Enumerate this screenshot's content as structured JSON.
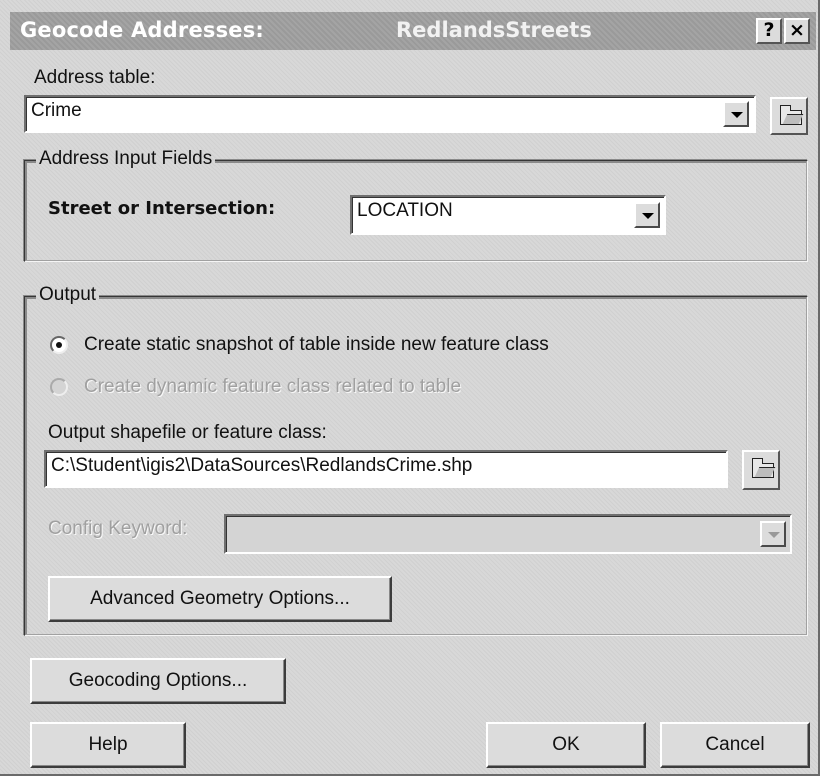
{
  "window": {
    "title": "Geocode Addresses:",
    "title_layer": "RedlandsStreets",
    "help_button": "?",
    "close_button": "×"
  },
  "address_table": {
    "label": "Address table:",
    "value": "Crime"
  },
  "address_input_fields": {
    "legend": "Address Input Fields",
    "street_label": "Street or Intersection:",
    "street_value": "LOCATION"
  },
  "output": {
    "legend": "Output",
    "radio_static_label": "Create static snapshot of table inside new feature class",
    "radio_dynamic_label": "Create dynamic feature class related to table",
    "selected_option": "static",
    "shapefile_label": "Output shapefile or feature class:",
    "shapefile_value": "C:\\Student\\igis2\\DataSources\\RedlandsCrime.shp",
    "config_keyword_label": "Config Keyword:",
    "config_keyword_value": "",
    "advanced_button": "Advanced Geometry Options..."
  },
  "buttons": {
    "geocoding_options": "Geocoding Options...",
    "help": "Help",
    "ok": "OK",
    "cancel": "Cancel"
  },
  "icons": {
    "browse": "open-folder-icon",
    "dropdown": "chevron-down-icon"
  }
}
